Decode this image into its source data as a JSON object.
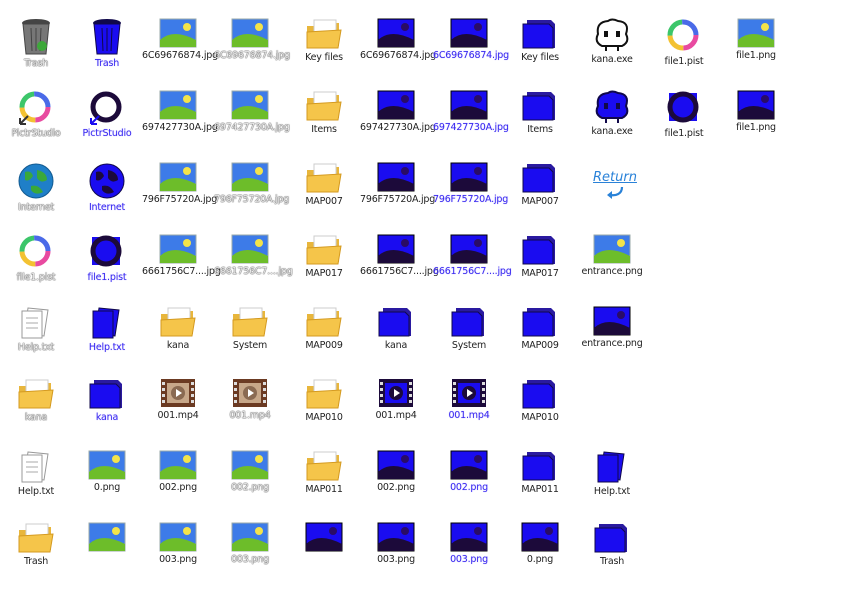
{
  "rows": [
    [
      {
        "label": "Trash",
        "icon": "trash-icon",
        "variant": "normal",
        "state": "ghost"
      },
      {
        "label": "Trash",
        "icon": "trash-icon",
        "variant": "blue",
        "state": "blue"
      },
      {
        "label": "6C69676874.jpg",
        "icon": "image-icon",
        "variant": "normal",
        "state": "normal"
      },
      {
        "label": "6C69676874.jpg",
        "icon": "image-icon",
        "variant": "normal",
        "state": "ghost"
      },
      {
        "label": "Key files",
        "icon": "folder-icon",
        "variant": "normal",
        "state": "normal"
      },
      {
        "label": "6C69676874.jpg",
        "icon": "image-icon",
        "variant": "blue",
        "state": "normal"
      },
      {
        "label": "6C69676874.jpg",
        "icon": "image-icon",
        "variant": "blue",
        "state": "blue"
      },
      {
        "label": "Key files",
        "icon": "folder-icon",
        "variant": "blue",
        "state": "normal"
      },
      {
        "label": "kana.exe",
        "icon": "character-icon",
        "variant": "normal",
        "state": "normal"
      },
      {
        "label": "file1.pist",
        "icon": "pictr-icon",
        "variant": "normal",
        "state": "normal"
      },
      {
        "label": "file1.png",
        "icon": "image-icon",
        "variant": "normal",
        "state": "normal"
      }
    ],
    [
      {
        "label": "PictrStudio",
        "icon": "pictr-app-icon",
        "variant": "normal",
        "state": "ghost"
      },
      {
        "label": "PictrStudio",
        "icon": "pictr-app-icon",
        "variant": "blue",
        "state": "blue"
      },
      {
        "label": "697427730A.jpg",
        "icon": "image-icon",
        "variant": "normal",
        "state": "normal"
      },
      {
        "label": "697427730A.jpg",
        "icon": "image-icon",
        "variant": "normal",
        "state": "ghost"
      },
      {
        "label": "Items",
        "icon": "folder-icon",
        "variant": "normal",
        "state": "normal"
      },
      {
        "label": "697427730A.jpg",
        "icon": "image-icon",
        "variant": "blue",
        "state": "normal"
      },
      {
        "label": "697427730A.jpg",
        "icon": "image-icon",
        "variant": "blue",
        "state": "blue"
      },
      {
        "label": "Items",
        "icon": "folder-icon",
        "variant": "blue",
        "state": "normal"
      },
      {
        "label": "kana.exe",
        "icon": "character-icon",
        "variant": "blue",
        "state": "normal"
      },
      {
        "label": "file1.pist",
        "icon": "pictr-icon",
        "variant": "blue",
        "state": "normal"
      },
      {
        "label": "file1.png",
        "icon": "image-icon",
        "variant": "blue",
        "state": "normal"
      }
    ],
    [
      {
        "label": "Internet",
        "icon": "globe-icon",
        "variant": "normal",
        "state": "ghost"
      },
      {
        "label": "Internet",
        "icon": "globe-icon",
        "variant": "blue",
        "state": "blue"
      },
      {
        "label": "796F75720A.jpg",
        "icon": "image-icon",
        "variant": "normal",
        "state": "normal"
      },
      {
        "label": "796F75720A.jpg",
        "icon": "image-icon",
        "variant": "normal",
        "state": "ghost"
      },
      {
        "label": "MAP007",
        "icon": "folder-icon",
        "variant": "normal",
        "state": "normal"
      },
      {
        "label": "796F75720A.jpg",
        "icon": "image-icon",
        "variant": "blue",
        "state": "normal"
      },
      {
        "label": "796F75720A.jpg",
        "icon": "image-icon",
        "variant": "blue",
        "state": "blue"
      },
      {
        "label": "MAP007",
        "icon": "folder-icon",
        "variant": "blue",
        "state": "normal"
      }
    ],
    [
      {
        "label": "file1.pist",
        "icon": "pictr-icon",
        "variant": "normal",
        "state": "ghost"
      },
      {
        "label": "file1.pist",
        "icon": "pictr-icon",
        "variant": "blue",
        "state": "blue"
      },
      {
        "label": "6661756C7....jpg",
        "icon": "image-icon",
        "variant": "normal",
        "state": "normal"
      },
      {
        "label": "6661756C7....jpg",
        "icon": "image-icon",
        "variant": "normal",
        "state": "ghost"
      },
      {
        "label": "MAP017",
        "icon": "folder-icon",
        "variant": "normal",
        "state": "normal"
      },
      {
        "label": "6661756C7....jpg",
        "icon": "image-icon",
        "variant": "blue",
        "state": "normal"
      },
      {
        "label": "6661756C7....jpg",
        "icon": "image-icon",
        "variant": "blue",
        "state": "blue"
      },
      {
        "label": "MAP017",
        "icon": "folder-icon",
        "variant": "blue",
        "state": "normal"
      },
      {
        "label": "entrance.png",
        "icon": "image-icon",
        "variant": "normal",
        "state": "normal"
      }
    ],
    [
      {
        "label": "Help.txt",
        "icon": "document-icon",
        "variant": "normal",
        "state": "ghost"
      },
      {
        "label": "Help.txt",
        "icon": "document-icon",
        "variant": "blue",
        "state": "blue"
      },
      {
        "label": "kana",
        "icon": "folder-icon",
        "variant": "normal",
        "state": "normal"
      },
      {
        "label": "System",
        "icon": "folder-icon",
        "variant": "normal",
        "state": "normal"
      },
      {
        "label": "MAP009",
        "icon": "folder-icon",
        "variant": "normal",
        "state": "normal"
      },
      {
        "label": "kana",
        "icon": "folder-icon",
        "variant": "blue",
        "state": "normal"
      },
      {
        "label": "System",
        "icon": "folder-icon",
        "variant": "blue",
        "state": "normal"
      },
      {
        "label": "MAP009",
        "icon": "folder-icon",
        "variant": "blue",
        "state": "normal"
      },
      {
        "label": "entrance.png",
        "icon": "image-icon",
        "variant": "blue",
        "state": "normal"
      }
    ],
    [
      {
        "label": "kana",
        "icon": "folder-icon",
        "variant": "normal",
        "state": "ghost"
      },
      {
        "label": "kana",
        "icon": "folder-icon",
        "variant": "blue",
        "state": "blue"
      },
      {
        "label": "001.mp4",
        "icon": "video-icon",
        "variant": "normal",
        "state": "normal"
      },
      {
        "label": "001.mp4",
        "icon": "video-icon",
        "variant": "normal",
        "state": "ghost"
      },
      {
        "label": "MAP010",
        "icon": "folder-icon",
        "variant": "normal",
        "state": "normal"
      },
      {
        "label": "001.mp4",
        "icon": "video-icon",
        "variant": "blue",
        "state": "normal"
      },
      {
        "label": "001.mp4",
        "icon": "video-icon",
        "variant": "blue",
        "state": "blue"
      },
      {
        "label": "MAP010",
        "icon": "folder-icon",
        "variant": "blue",
        "state": "normal"
      }
    ],
    [
      {
        "label": "Help.txt",
        "icon": "document-icon",
        "variant": "normal",
        "state": "normal"
      },
      {
        "label": "0.png",
        "icon": "image-icon",
        "variant": "normal",
        "state": "normal"
      },
      {
        "label": "002.png",
        "icon": "image-icon",
        "variant": "normal",
        "state": "normal"
      },
      {
        "label": "002.png",
        "icon": "image-icon",
        "variant": "normal",
        "state": "ghost"
      },
      {
        "label": "MAP011",
        "icon": "folder-icon",
        "variant": "normal",
        "state": "normal"
      },
      {
        "label": "002.png",
        "icon": "image-icon",
        "variant": "blue",
        "state": "normal"
      },
      {
        "label": "002.png",
        "icon": "image-icon",
        "variant": "blue",
        "state": "blue"
      },
      {
        "label": "MAP011",
        "icon": "folder-icon",
        "variant": "blue",
        "state": "normal"
      },
      {
        "label": "Help.txt",
        "icon": "document-icon",
        "variant": "blue",
        "state": "normal"
      }
    ],
    [
      {
        "label": "Trash",
        "icon": "folder-icon",
        "variant": "normal",
        "state": "normal"
      },
      {
        "label": "",
        "icon": "image-icon",
        "variant": "normal",
        "state": "normal"
      },
      {
        "label": "003.png",
        "icon": "image-icon",
        "variant": "normal",
        "state": "normal"
      },
      {
        "label": "003.png",
        "icon": "image-icon",
        "variant": "normal",
        "state": "ghost"
      },
      {
        "label": "",
        "icon": "image-icon",
        "variant": "blue",
        "state": "normal"
      },
      {
        "label": "003.png",
        "icon": "image-icon",
        "variant": "blue",
        "state": "normal"
      },
      {
        "label": "003.png",
        "icon": "image-icon",
        "variant": "blue",
        "state": "blue"
      },
      {
        "label": "0.png",
        "icon": "image-icon",
        "variant": "blue",
        "state": "normal"
      },
      {
        "label": "Trash",
        "icon": "folder-icon",
        "variant": "blue",
        "state": "normal"
      }
    ]
  ],
  "return_link": {
    "label": "Return",
    "icon": "return-arrow-icon"
  },
  "colors": {
    "sky": "#3d7be8",
    "grass": "#6dbd2a",
    "sun": "#f3e34a",
    "blue_fill": "#1a0cf0",
    "blue_dark": "#1c0a3a",
    "folder": "#f5c54a",
    "accent_text": "#3a2af0"
  }
}
